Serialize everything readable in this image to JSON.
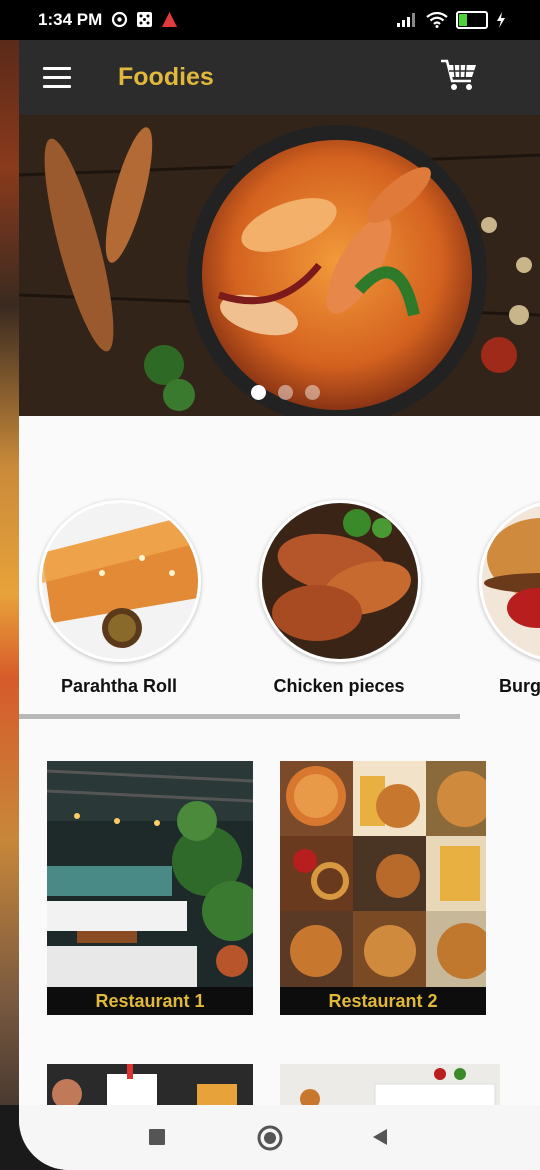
{
  "status_bar": {
    "time": "1:34 PM",
    "battery": "29"
  },
  "app_bar": {
    "title": "Foodies"
  },
  "carousel": {
    "slide_count": 3,
    "active_index": 0
  },
  "categories": [
    {
      "label": "Parahtha Roll"
    },
    {
      "label": "Chicken pieces"
    },
    {
      "label": "Burg"
    }
  ],
  "restaurants": [
    {
      "label": "Restaurant 1"
    },
    {
      "label": "Restaurant 2"
    }
  ],
  "colors": {
    "app_bar": "#2c2c2c",
    "title": "#e0b83c",
    "label_bg": "#0d0d0d"
  }
}
